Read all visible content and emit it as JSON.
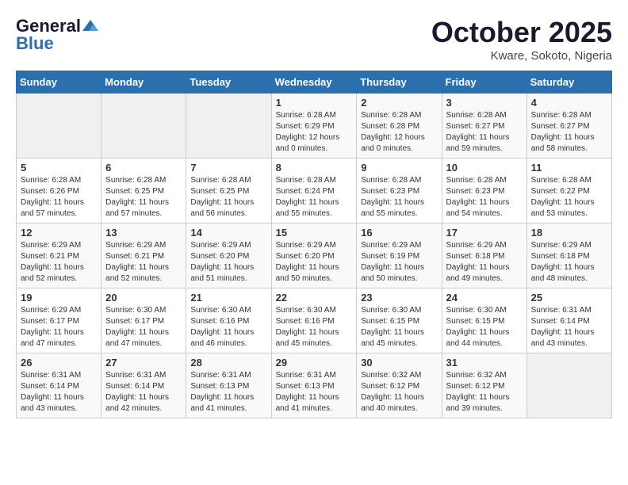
{
  "header": {
    "logo_line1": "General",
    "logo_line2": "Blue",
    "month_title": "October 2025",
    "subtitle": "Kware, Sokoto, Nigeria"
  },
  "weekdays": [
    "Sunday",
    "Monday",
    "Tuesday",
    "Wednesday",
    "Thursday",
    "Friday",
    "Saturday"
  ],
  "weeks": [
    [
      {
        "day": "",
        "info": ""
      },
      {
        "day": "",
        "info": ""
      },
      {
        "day": "",
        "info": ""
      },
      {
        "day": "1",
        "info": "Sunrise: 6:28 AM\nSunset: 6:29 PM\nDaylight: 12 hours\nand 0 minutes."
      },
      {
        "day": "2",
        "info": "Sunrise: 6:28 AM\nSunset: 6:28 PM\nDaylight: 12 hours\nand 0 minutes."
      },
      {
        "day": "3",
        "info": "Sunrise: 6:28 AM\nSunset: 6:27 PM\nDaylight: 11 hours\nand 59 minutes."
      },
      {
        "day": "4",
        "info": "Sunrise: 6:28 AM\nSunset: 6:27 PM\nDaylight: 11 hours\nand 58 minutes."
      }
    ],
    [
      {
        "day": "5",
        "info": "Sunrise: 6:28 AM\nSunset: 6:26 PM\nDaylight: 11 hours\nand 57 minutes."
      },
      {
        "day": "6",
        "info": "Sunrise: 6:28 AM\nSunset: 6:25 PM\nDaylight: 11 hours\nand 57 minutes."
      },
      {
        "day": "7",
        "info": "Sunrise: 6:28 AM\nSunset: 6:25 PM\nDaylight: 11 hours\nand 56 minutes."
      },
      {
        "day": "8",
        "info": "Sunrise: 6:28 AM\nSunset: 6:24 PM\nDaylight: 11 hours\nand 55 minutes."
      },
      {
        "day": "9",
        "info": "Sunrise: 6:28 AM\nSunset: 6:23 PM\nDaylight: 11 hours\nand 55 minutes."
      },
      {
        "day": "10",
        "info": "Sunrise: 6:28 AM\nSunset: 6:23 PM\nDaylight: 11 hours\nand 54 minutes."
      },
      {
        "day": "11",
        "info": "Sunrise: 6:28 AM\nSunset: 6:22 PM\nDaylight: 11 hours\nand 53 minutes."
      }
    ],
    [
      {
        "day": "12",
        "info": "Sunrise: 6:29 AM\nSunset: 6:21 PM\nDaylight: 11 hours\nand 52 minutes."
      },
      {
        "day": "13",
        "info": "Sunrise: 6:29 AM\nSunset: 6:21 PM\nDaylight: 11 hours\nand 52 minutes."
      },
      {
        "day": "14",
        "info": "Sunrise: 6:29 AM\nSunset: 6:20 PM\nDaylight: 11 hours\nand 51 minutes."
      },
      {
        "day": "15",
        "info": "Sunrise: 6:29 AM\nSunset: 6:20 PM\nDaylight: 11 hours\nand 50 minutes."
      },
      {
        "day": "16",
        "info": "Sunrise: 6:29 AM\nSunset: 6:19 PM\nDaylight: 11 hours\nand 50 minutes."
      },
      {
        "day": "17",
        "info": "Sunrise: 6:29 AM\nSunset: 6:18 PM\nDaylight: 11 hours\nand 49 minutes."
      },
      {
        "day": "18",
        "info": "Sunrise: 6:29 AM\nSunset: 6:18 PM\nDaylight: 11 hours\nand 48 minutes."
      }
    ],
    [
      {
        "day": "19",
        "info": "Sunrise: 6:29 AM\nSunset: 6:17 PM\nDaylight: 11 hours\nand 47 minutes."
      },
      {
        "day": "20",
        "info": "Sunrise: 6:30 AM\nSunset: 6:17 PM\nDaylight: 11 hours\nand 47 minutes."
      },
      {
        "day": "21",
        "info": "Sunrise: 6:30 AM\nSunset: 6:16 PM\nDaylight: 11 hours\nand 46 minutes."
      },
      {
        "day": "22",
        "info": "Sunrise: 6:30 AM\nSunset: 6:16 PM\nDaylight: 11 hours\nand 45 minutes."
      },
      {
        "day": "23",
        "info": "Sunrise: 6:30 AM\nSunset: 6:15 PM\nDaylight: 11 hours\nand 45 minutes."
      },
      {
        "day": "24",
        "info": "Sunrise: 6:30 AM\nSunset: 6:15 PM\nDaylight: 11 hours\nand 44 minutes."
      },
      {
        "day": "25",
        "info": "Sunrise: 6:31 AM\nSunset: 6:14 PM\nDaylight: 11 hours\nand 43 minutes."
      }
    ],
    [
      {
        "day": "26",
        "info": "Sunrise: 6:31 AM\nSunset: 6:14 PM\nDaylight: 11 hours\nand 43 minutes."
      },
      {
        "day": "27",
        "info": "Sunrise: 6:31 AM\nSunset: 6:14 PM\nDaylight: 11 hours\nand 42 minutes."
      },
      {
        "day": "28",
        "info": "Sunrise: 6:31 AM\nSunset: 6:13 PM\nDaylight: 11 hours\nand 41 minutes."
      },
      {
        "day": "29",
        "info": "Sunrise: 6:31 AM\nSunset: 6:13 PM\nDaylight: 11 hours\nand 41 minutes."
      },
      {
        "day": "30",
        "info": "Sunrise: 6:32 AM\nSunset: 6:12 PM\nDaylight: 11 hours\nand 40 minutes."
      },
      {
        "day": "31",
        "info": "Sunrise: 6:32 AM\nSunset: 6:12 PM\nDaylight: 11 hours\nand 39 minutes."
      },
      {
        "day": "",
        "info": ""
      }
    ]
  ]
}
